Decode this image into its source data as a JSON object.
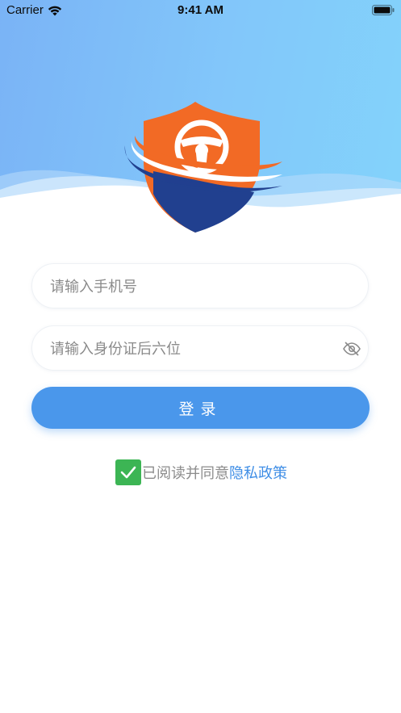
{
  "status_bar": {
    "carrier": "Carrier",
    "time": "9:41 AM"
  },
  "icons": {
    "wifi": "wifi-icon",
    "battery": "battery-icon",
    "logo": "shield-steering-wheel-logo",
    "eye": "eye-closed-icon",
    "check": "checkmark-icon"
  },
  "form": {
    "phone_placeholder": "请输入手机号",
    "phone_value": "",
    "id_placeholder": "请输入身份证后六位",
    "id_value": "",
    "login_label": "登录"
  },
  "agreement": {
    "checked": true,
    "text": "已阅读并同意",
    "link_label": "隐私政策"
  },
  "colors": {
    "header_gradient_start": "#7ab3f6",
    "header_gradient_end": "#83d3fb",
    "button": "#4a97eb",
    "checkbox": "#3cb554",
    "link": "#3f8ee6",
    "logo_orange": "#f26a25",
    "logo_navy": "#21408f"
  }
}
